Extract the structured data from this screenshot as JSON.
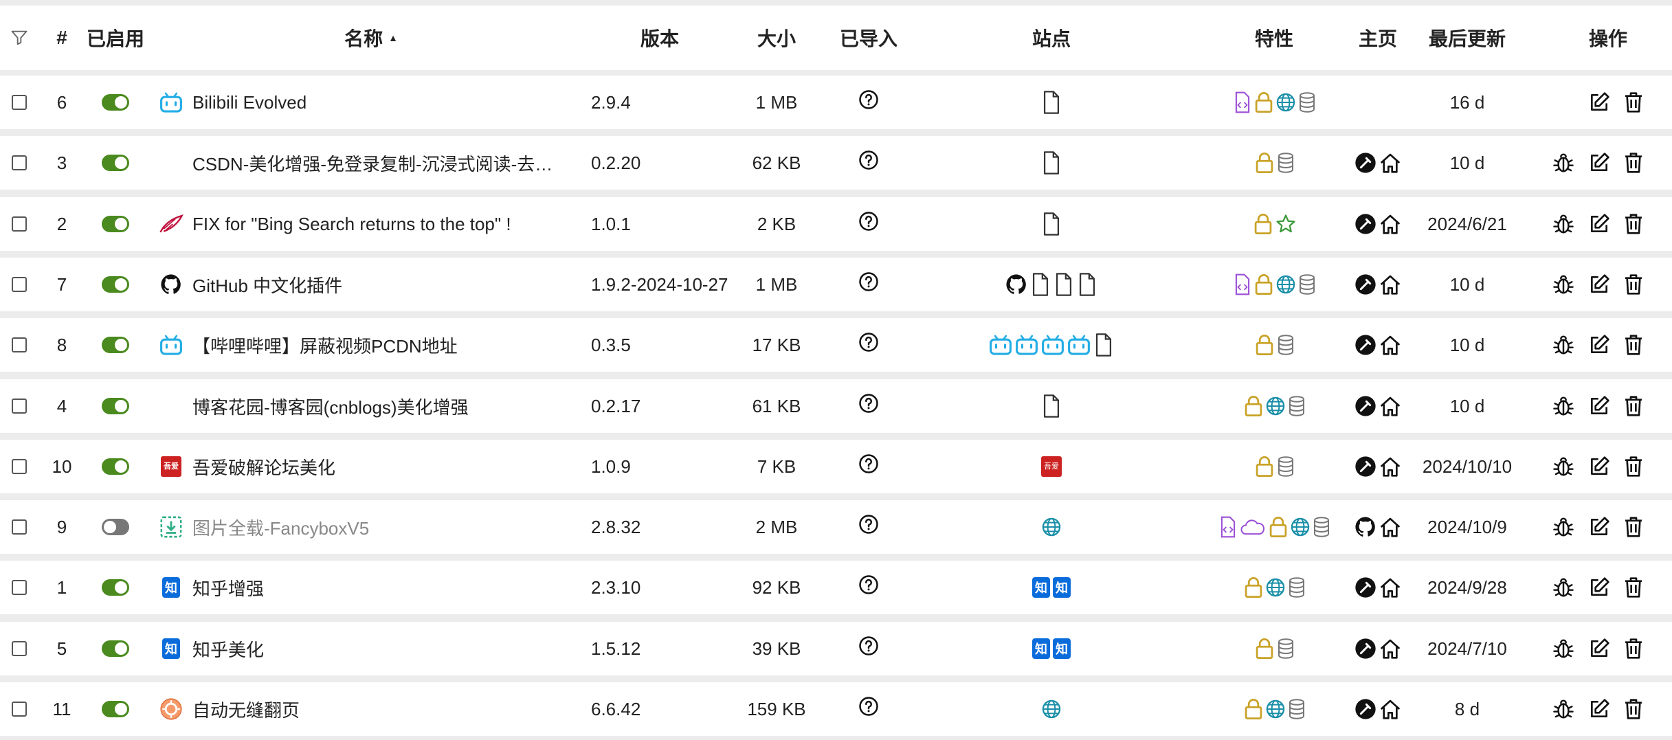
{
  "header": {
    "filter_icon": "filter-icon",
    "num": "#",
    "enabled": "已启用",
    "name": "名称",
    "name_sort": "▲",
    "version": "版本",
    "size": "大小",
    "imported": "已导入",
    "sites": "站点",
    "features": "特性",
    "homepage": "主页",
    "updated": "最后更新",
    "actions": "操作"
  },
  "colors": {
    "toggle_on": "#4a8a1e",
    "toggle_off": "#777777",
    "lock": "#c9a227",
    "globe": "#1a8fa8",
    "code": "#9b4fd6",
    "database": "#777777",
    "star": "#3a9a3a",
    "bilibili": "#23ade5",
    "zhihu": "#0a6cdb",
    "wuai": "#cc2222"
  },
  "rows": [
    {
      "id": "6",
      "enabled": true,
      "brand": "bilibili-tv-icon",
      "name": "Bilibili Evolved",
      "version": "2.9.4",
      "size": "1 MB",
      "sites": [
        "file-icon"
      ],
      "features": [
        "code-icon",
        "lock-icon",
        "globe-icon",
        "database-icon"
      ],
      "home": [],
      "updated": "16 d",
      "debug": false
    },
    {
      "id": "3",
      "enabled": true,
      "brand": "none",
      "name": "CSDN-美化增强-免登录复制-沉浸式阅读-去…",
      "version": "0.2.20",
      "size": "62 KB",
      "sites": [
        "file-icon"
      ],
      "features": [
        "lock-icon",
        "database-icon"
      ],
      "home": [
        "greasyfork-icon",
        "home-icon"
      ],
      "updated": "10 d",
      "debug": true
    },
    {
      "id": "2",
      "enabled": true,
      "brand": "bing-feather-icon",
      "name": "FIX for \"Bing Search returns to the top\" !",
      "version": "1.0.1",
      "size": "2 KB",
      "sites": [
        "file-icon"
      ],
      "features": [
        "lock-icon",
        "star-icon"
      ],
      "home": [
        "greasyfork-icon",
        "home-icon"
      ],
      "updated": "2024/6/21",
      "debug": true
    },
    {
      "id": "7",
      "enabled": true,
      "brand": "github-icon",
      "name": "GitHub 中文化插件",
      "version": "1.9.2-2024-10-27",
      "size": "1 MB",
      "sites": [
        "github-icon",
        "file-icon",
        "file-icon",
        "file-icon"
      ],
      "features": [
        "code-icon",
        "lock-icon",
        "globe-icon",
        "database-icon"
      ],
      "home": [
        "greasyfork-icon",
        "home-icon"
      ],
      "updated": "10 d",
      "debug": true
    },
    {
      "id": "8",
      "enabled": true,
      "brand": "bilibili-tv-icon",
      "name": "【哔哩哔哩】屏蔽视频PCDN地址",
      "version": "0.3.5",
      "size": "17 KB",
      "sites": [
        "bilibili-tv-icon",
        "bilibili-tv-icon",
        "bilibili-tv-icon",
        "bilibili-tv-icon",
        "file-icon"
      ],
      "features": [
        "lock-icon",
        "database-icon"
      ],
      "home": [
        "greasyfork-icon",
        "home-icon"
      ],
      "updated": "10 d",
      "debug": true
    },
    {
      "id": "4",
      "enabled": true,
      "brand": "none",
      "name": "博客花园-博客园(cnblogs)美化增强",
      "version": "0.2.17",
      "size": "61 KB",
      "sites": [
        "file-icon"
      ],
      "features": [
        "lock-icon",
        "globe-icon",
        "database-icon"
      ],
      "home": [
        "greasyfork-icon",
        "home-icon"
      ],
      "updated": "10 d",
      "debug": true
    },
    {
      "id": "10",
      "enabled": true,
      "brand": "wuai-icon",
      "name": "吾爱破解论坛美化",
      "version": "1.0.9",
      "size": "7 KB",
      "sites": [
        "wuai-icon"
      ],
      "features": [
        "lock-icon",
        "database-icon"
      ],
      "home": [
        "greasyfork-icon",
        "home-icon"
      ],
      "updated": "2024/10/10",
      "debug": true
    },
    {
      "id": "9",
      "enabled": false,
      "brand": "download-icon",
      "name": "图片全载-FancyboxV5",
      "version": "2.8.32",
      "size": "2 MB",
      "sites": [
        "globe-icon"
      ],
      "features": [
        "code-icon",
        "cloud-icon",
        "lock-icon",
        "globe-icon",
        "database-icon"
      ],
      "home": [
        "github-icon",
        "home-icon"
      ],
      "updated": "2024/10/9",
      "debug": true
    },
    {
      "id": "1",
      "enabled": true,
      "brand": "zhihu-icon",
      "name": "知乎增强",
      "version": "2.3.10",
      "size": "92 KB",
      "sites": [
        "zhihu-icon",
        "zhihu-icon"
      ],
      "features": [
        "lock-icon",
        "globe-icon",
        "database-icon"
      ],
      "home": [
        "greasyfork-icon",
        "home-icon"
      ],
      "updated": "2024/9/28",
      "debug": true
    },
    {
      "id": "5",
      "enabled": true,
      "brand": "zhihu-icon",
      "name": "知乎美化",
      "version": "1.5.12",
      "size": "39 KB",
      "sites": [
        "zhihu-icon",
        "zhihu-icon"
      ],
      "features": [
        "lock-icon",
        "database-icon"
      ],
      "home": [
        "greasyfork-icon",
        "home-icon"
      ],
      "updated": "2024/7/10",
      "debug": true
    },
    {
      "id": "11",
      "enabled": true,
      "brand": "autopager-icon",
      "name": "自动无缝翻页",
      "version": "6.6.42",
      "size": "159 KB",
      "sites": [
        "globe-icon"
      ],
      "features": [
        "lock-icon",
        "globe-icon",
        "database-icon"
      ],
      "home": [
        "greasyfork-icon",
        "home-icon"
      ],
      "updated": "8 d",
      "debug": true
    }
  ],
  "imported_icon": "question-circle-icon",
  "zhihu_glyph": "知",
  "wuai_glyph": "吾爱"
}
